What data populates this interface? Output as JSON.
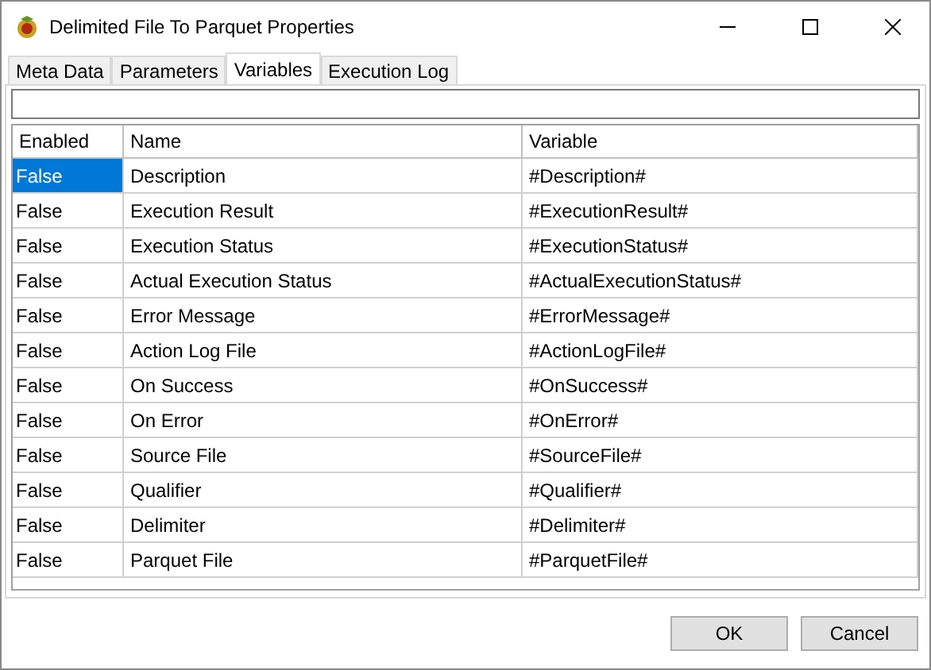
{
  "window": {
    "title": "Delimited File To Parquet Properties"
  },
  "tabs": [
    {
      "label": "Meta Data",
      "selected": false
    },
    {
      "label": "Parameters",
      "selected": false
    },
    {
      "label": "Variables",
      "selected": true
    },
    {
      "label": "Execution Log",
      "selected": false
    }
  ],
  "table": {
    "columns": [
      "Enabled",
      "Name",
      "Variable"
    ],
    "rows": [
      {
        "enabled": "False",
        "name": "Description",
        "variable": "#Description#",
        "selected": true
      },
      {
        "enabled": "False",
        "name": "Execution Result",
        "variable": "#ExecutionResult#",
        "selected": false
      },
      {
        "enabled": "False",
        "name": "Execution Status",
        "variable": "#ExecutionStatus#",
        "selected": false
      },
      {
        "enabled": "False",
        "name": "Actual Execution Status",
        "variable": "#ActualExecutionStatus#",
        "selected": false
      },
      {
        "enabled": "False",
        "name": "Error Message",
        "variable": "#ErrorMessage#",
        "selected": false
      },
      {
        "enabled": "False",
        "name": "Action Log File",
        "variable": "#ActionLogFile#",
        "selected": false
      },
      {
        "enabled": "False",
        "name": "On Success",
        "variable": "#OnSuccess#",
        "selected": false
      },
      {
        "enabled": "False",
        "name": "On Error",
        "variable": "#OnError#",
        "selected": false
      },
      {
        "enabled": "False",
        "name": "Source File",
        "variable": "#SourceFile#",
        "selected": false
      },
      {
        "enabled": "False",
        "name": "Qualifier",
        "variable": "#Qualifier#",
        "selected": false
      },
      {
        "enabled": "False",
        "name": "Delimiter",
        "variable": "#Delimiter#",
        "selected": false
      },
      {
        "enabled": "False",
        "name": "Parquet File",
        "variable": "#ParquetFile#",
        "selected": false
      }
    ]
  },
  "buttons": [
    "OK",
    "Cancel"
  ]
}
